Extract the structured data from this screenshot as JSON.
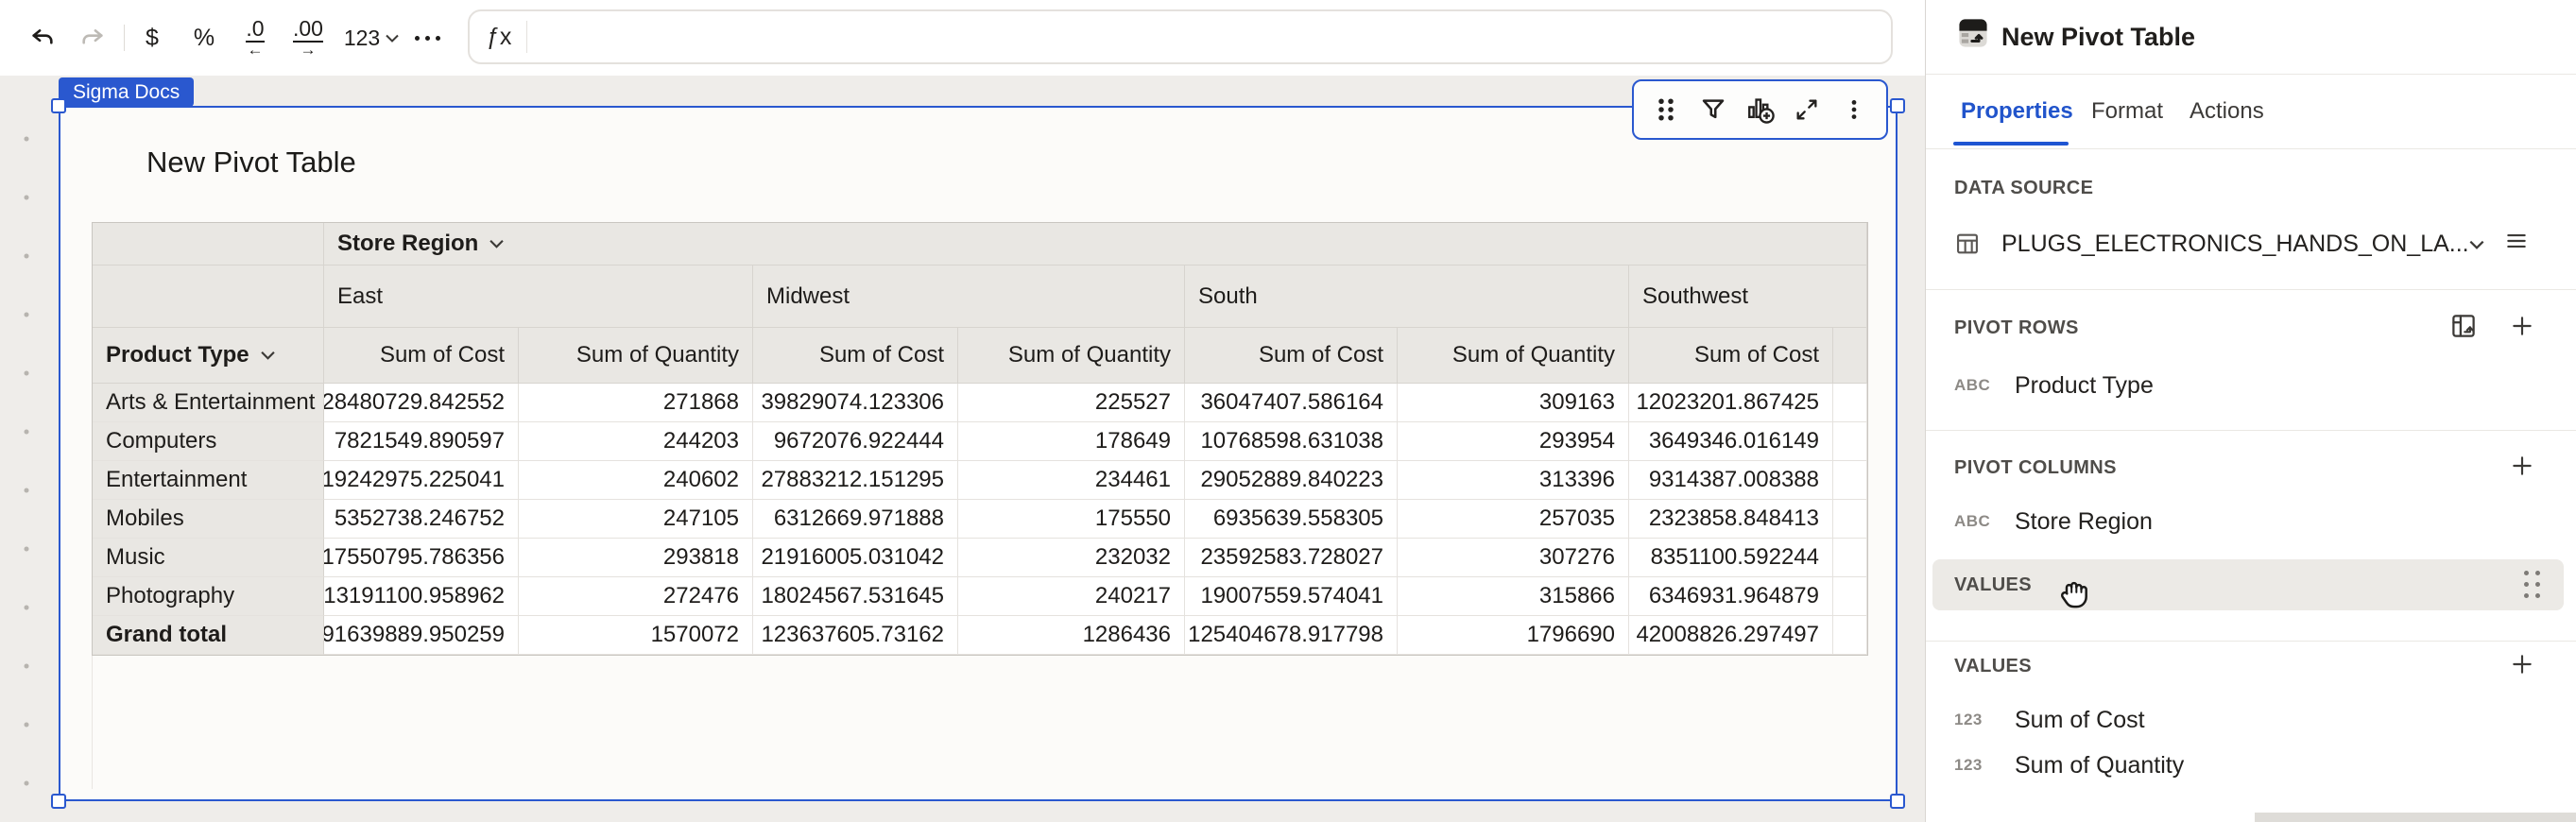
{
  "toolbar": {
    "currency": "$",
    "percent": "%",
    "decimal_decrease": ".0",
    "decimal_decrease_arrow": "←",
    "decimal_increase": ".00",
    "decimal_increase_arrow": "→",
    "number_format": "123",
    "fx_label": "ƒx",
    "formula_value": ""
  },
  "canvas": {
    "doc_tag": "Sigma Docs",
    "element_title": "New Pivot Table"
  },
  "pivot": {
    "column_dim_label": "Store Region",
    "row_dim_label": "Product Type",
    "col_groups": [
      "East",
      "Midwest",
      "South",
      "Southwest"
    ],
    "measure_headers": [
      "Sum of Cost",
      "Sum of Quantity",
      "Sum of Cost",
      "Sum of Quantity",
      "Sum of Cost",
      "Sum of Quantity",
      "Sum of Cost"
    ],
    "rows": [
      {
        "label": "Arts & Entertainment",
        "values": [
          "28480729.842552",
          "271868",
          "39829074.123306",
          "225527",
          "36047407.586164",
          "309163",
          "12023201.867425"
        ]
      },
      {
        "label": "Computers",
        "values": [
          "7821549.890597",
          "244203",
          "9672076.922444",
          "178649",
          "10768598.631038",
          "293954",
          "3649346.016149"
        ]
      },
      {
        "label": "Entertainment",
        "values": [
          "19242975.225041",
          "240602",
          "27883212.151295",
          "234461",
          "29052889.840223",
          "313396",
          "9314387.008388"
        ]
      },
      {
        "label": "Mobiles",
        "values": [
          "5352738.246752",
          "247105",
          "6312669.971888",
          "175550",
          "6935639.558305",
          "257035",
          "2323858.848413"
        ]
      },
      {
        "label": "Music",
        "values": [
          "17550795.786356",
          "293818",
          "21916005.031042",
          "232032",
          "23592583.728027",
          "307276",
          "8351100.592244"
        ]
      },
      {
        "label": "Photography",
        "values": [
          "13191100.958962",
          "272476",
          "18024567.531645",
          "240217",
          "19007559.574041",
          "315866",
          "6346931.964879"
        ]
      },
      {
        "label": "Grand total",
        "values": [
          "91639889.950259",
          "1570072",
          "123637605.73162",
          "1286436",
          "125404678.917798",
          "1796690",
          "42008826.297497"
        ],
        "is_total": true
      }
    ]
  },
  "panel": {
    "title": "New Pivot Table",
    "tabs": [
      {
        "label": "Properties",
        "active": true
      },
      {
        "label": "Format",
        "active": false
      },
      {
        "label": "Actions",
        "active": false
      }
    ],
    "data_source": {
      "label": "DATA SOURCE",
      "value": "PLUGS_ELECTRONICS_HANDS_ON_LA..."
    },
    "pivot_rows": {
      "label": "PIVOT ROWS",
      "items": [
        {
          "type": "ABC",
          "name": "Product Type"
        }
      ]
    },
    "pivot_columns": {
      "label": "PIVOT COLUMNS",
      "items": [
        {
          "type": "ABC",
          "name": "Store Region"
        }
      ]
    },
    "values_drag_chip": {
      "label": "VALUES"
    },
    "values": {
      "label": "VALUES",
      "items": [
        {
          "type": "123",
          "name": "Sum of Cost"
        },
        {
          "type": "123",
          "name": "Sum of Quantity"
        }
      ]
    }
  }
}
